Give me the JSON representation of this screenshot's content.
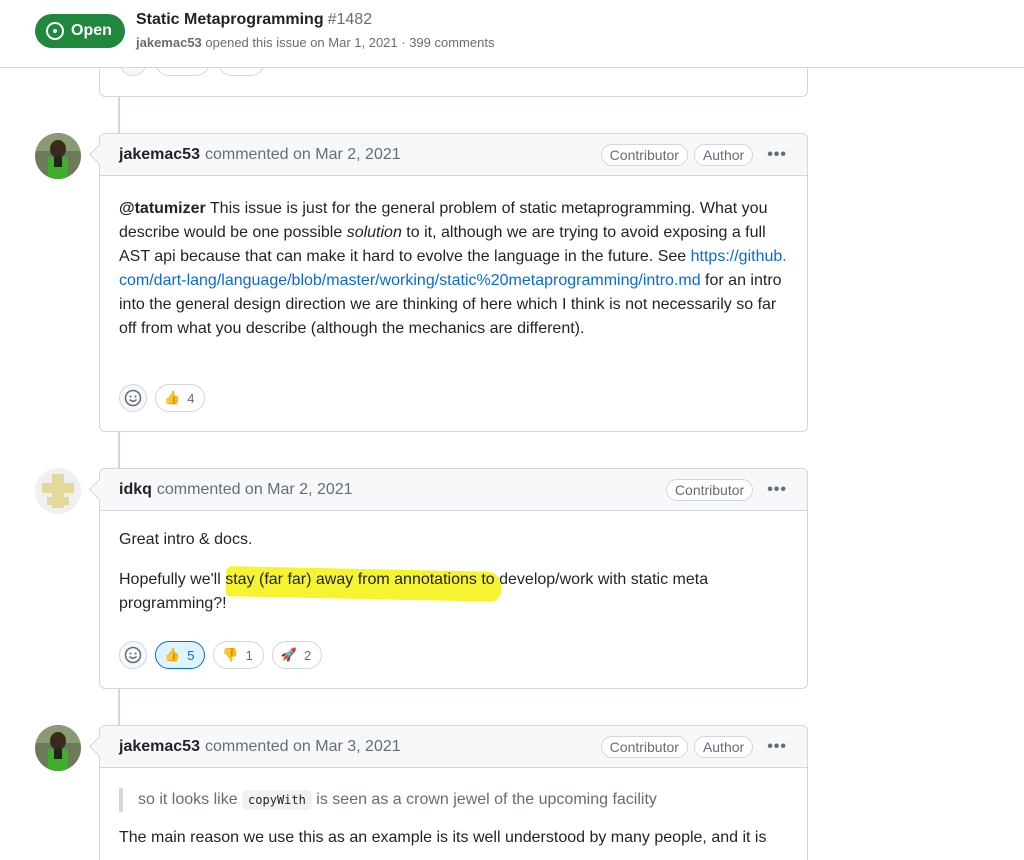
{
  "issue": {
    "state": "Open",
    "title": "Static Metaprogramming",
    "number": "#1482",
    "author": "jakemac53",
    "meta": "opened this issue on Mar 1, 2021 · 399 comments"
  },
  "comments": [
    {
      "author": "jakemac53",
      "date": "commented on Mar 2, 2021",
      "labels": [
        "Contributor",
        "Author"
      ],
      "mention": "@tatumizer",
      "text1": " This issue is just for the general problem of static metaprogramming. What you describe would be one possible ",
      "emph": "solution",
      "text2": " to it, although we are trying to avoid exposing a full AST api because that can make it hard to evolve the language in the future. See ",
      "link": "https://github.com/dart-lang/language/blob/master/working/static%20metaprogramming/intro.md",
      "text3": " for an intro into the general design direction we are thinking of here which I think is not necessarily so far off from what you describe (although the mechanics are different).",
      "reactions": [
        {
          "emoji": "👍",
          "count": "4"
        }
      ]
    },
    {
      "author": "idkq",
      "date": "commented on Mar 2, 2021",
      "labels": [
        "Contributor"
      ],
      "para1": "Great intro & docs.",
      "para2_start": "Hopefully we'll ",
      "para2_highlight": "stay (far far) away from annotations to",
      "para2_end": " develop/work with static meta programming?!",
      "reactions": [
        {
          "emoji": "👍",
          "count": "5"
        },
        {
          "emoji": "👎",
          "count": "1"
        },
        {
          "emoji": "🚀",
          "count": "2"
        }
      ]
    },
    {
      "author": "jakemac53",
      "date": "commented on Mar 3, 2021",
      "labels": [
        "Contributor",
        "Author"
      ],
      "quote_start": "so it looks like ",
      "quote_code": "copyWith",
      "quote_end": " is seen as a crown jewel of the upcoming facility",
      "para1": "The main reason we use this as an example is its well understood by many people, and it is"
    }
  ],
  "colors": {
    "open_green": "#1f883d",
    "link_blue": "#0969da",
    "highlight_yellow": "#f5f21a"
  }
}
